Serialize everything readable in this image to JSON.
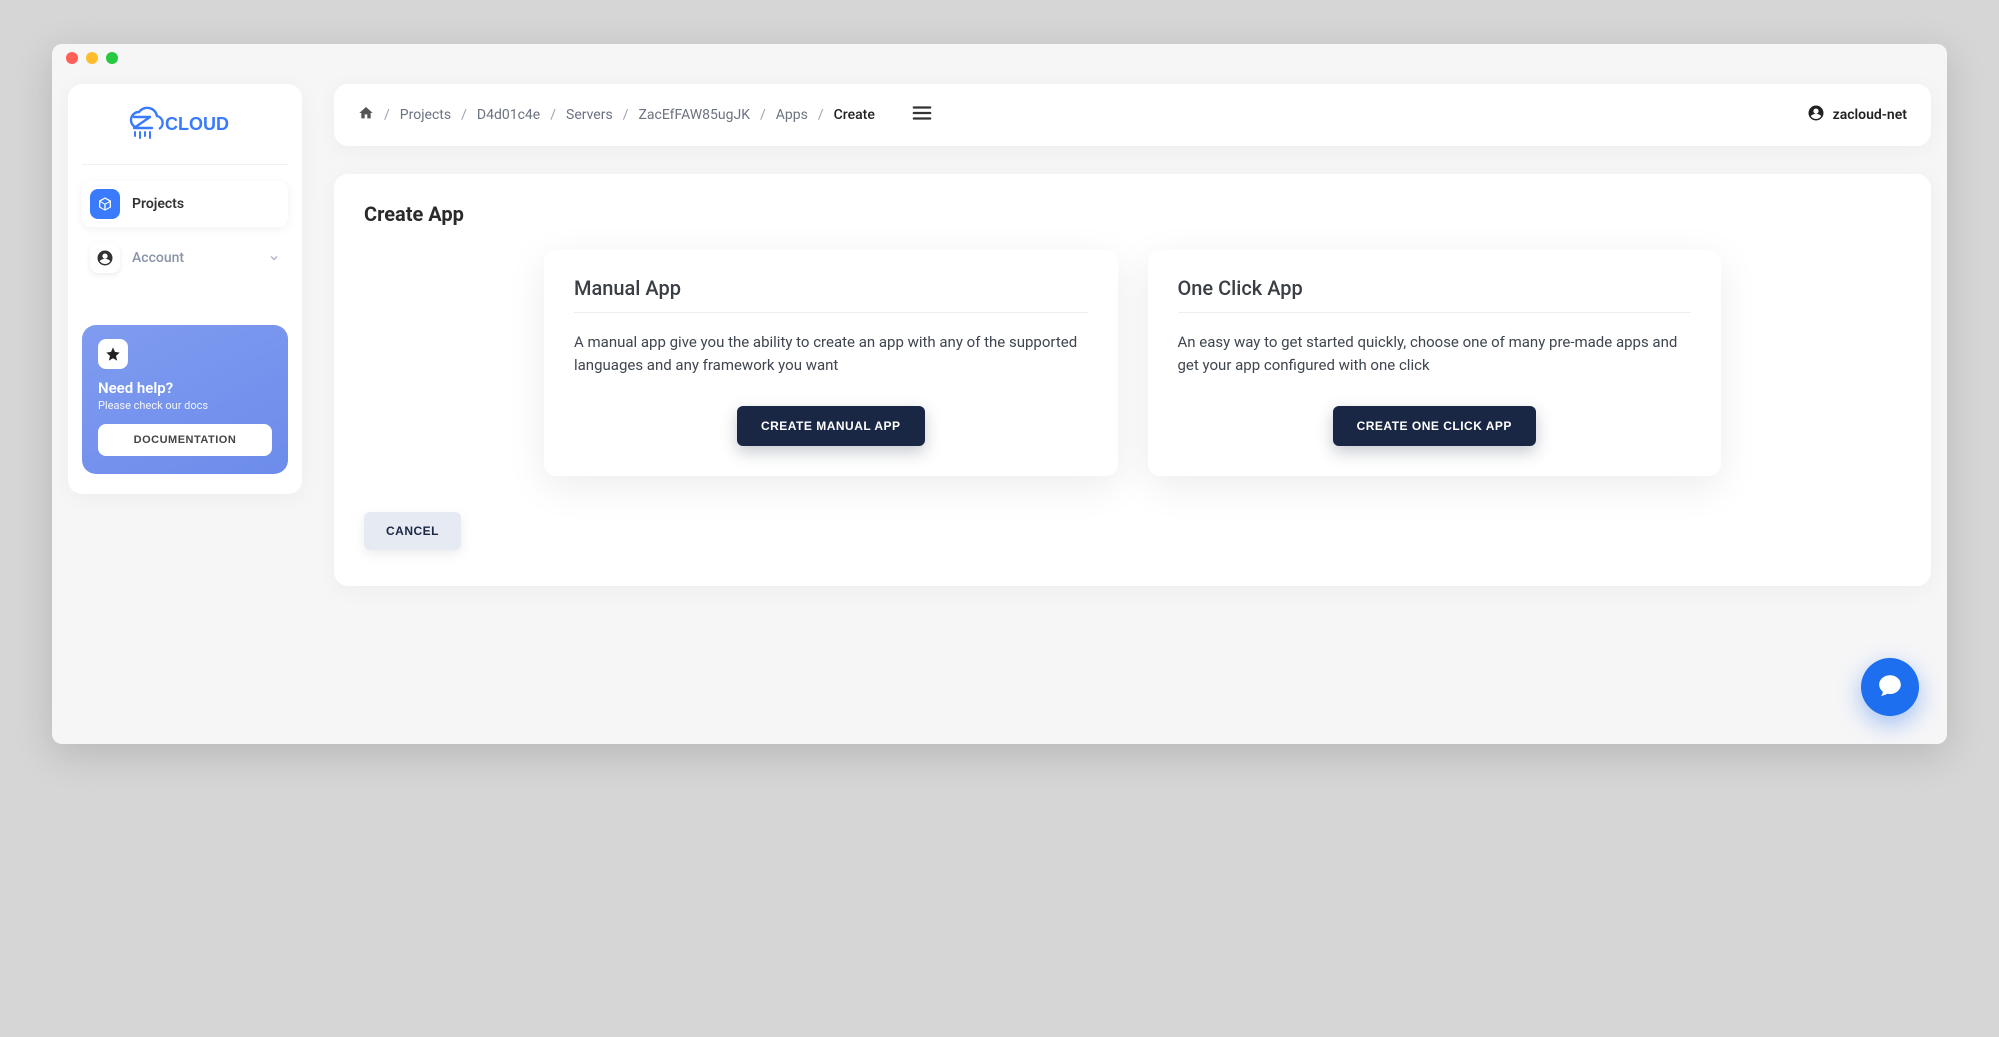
{
  "logo_text": "CLOUD",
  "sidebar": {
    "items": [
      {
        "label": "Projects"
      },
      {
        "label": "Account"
      }
    ],
    "help": {
      "title": "Need help?",
      "subtitle": "Please check our docs",
      "button": "DOCUMENTATION"
    }
  },
  "breadcrumbs": [
    "Projects",
    "D4d01c4e",
    "Servers",
    "ZacEfFAW85ugJK",
    "Apps",
    "Create"
  ],
  "account_name": "zacloud-net",
  "page": {
    "title": "Create App",
    "options": [
      {
        "title": "Manual App",
        "description": "A manual app give you the ability to create an app with any of the supported languages and any framework you want",
        "button": "CREATE MANUAL APP"
      },
      {
        "title": "One Click App",
        "description": "An easy way to get started quickly, choose one of many pre-made apps and get your app configured with one click",
        "button": "CREATE ONE CLICK APP"
      }
    ],
    "cancel": "CANCEL"
  }
}
